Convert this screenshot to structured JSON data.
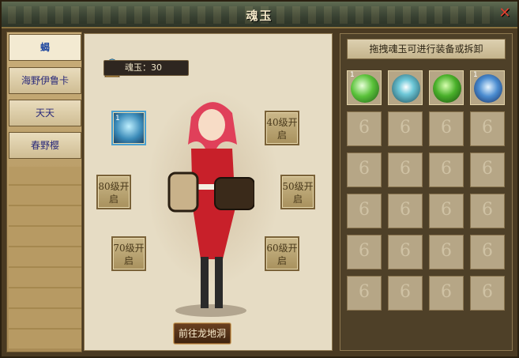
{
  "window": {
    "title": "魂玉",
    "close_icon": "close-icon"
  },
  "tabs": [
    {
      "label": "蝎",
      "active": true
    },
    {
      "label": "海野伊鲁卡",
      "active": false
    },
    {
      "label": "天天",
      "active": false
    },
    {
      "label": "春野樱",
      "active": false
    }
  ],
  "center": {
    "soul_count_label": "魂玉：30",
    "equipped_slot_count": "1",
    "locked_slots": [
      {
        "label": "40级开启"
      },
      {
        "label": "50级开启"
      },
      {
        "label": "60级开启"
      },
      {
        "label": "70级开启"
      },
      {
        "label": "80级开启"
      }
    ],
    "go_button_label": "前往龙地洞"
  },
  "inventory": {
    "hint": "拖拽魂玉可进行装备或拆卸",
    "filled_items": [
      {
        "count": "1",
        "gem": "green"
      },
      {
        "count": "",
        "gem": "teal"
      },
      {
        "count": "",
        "gem": "leaf"
      },
      {
        "count": "1",
        "gem": "blue"
      }
    ]
  }
}
